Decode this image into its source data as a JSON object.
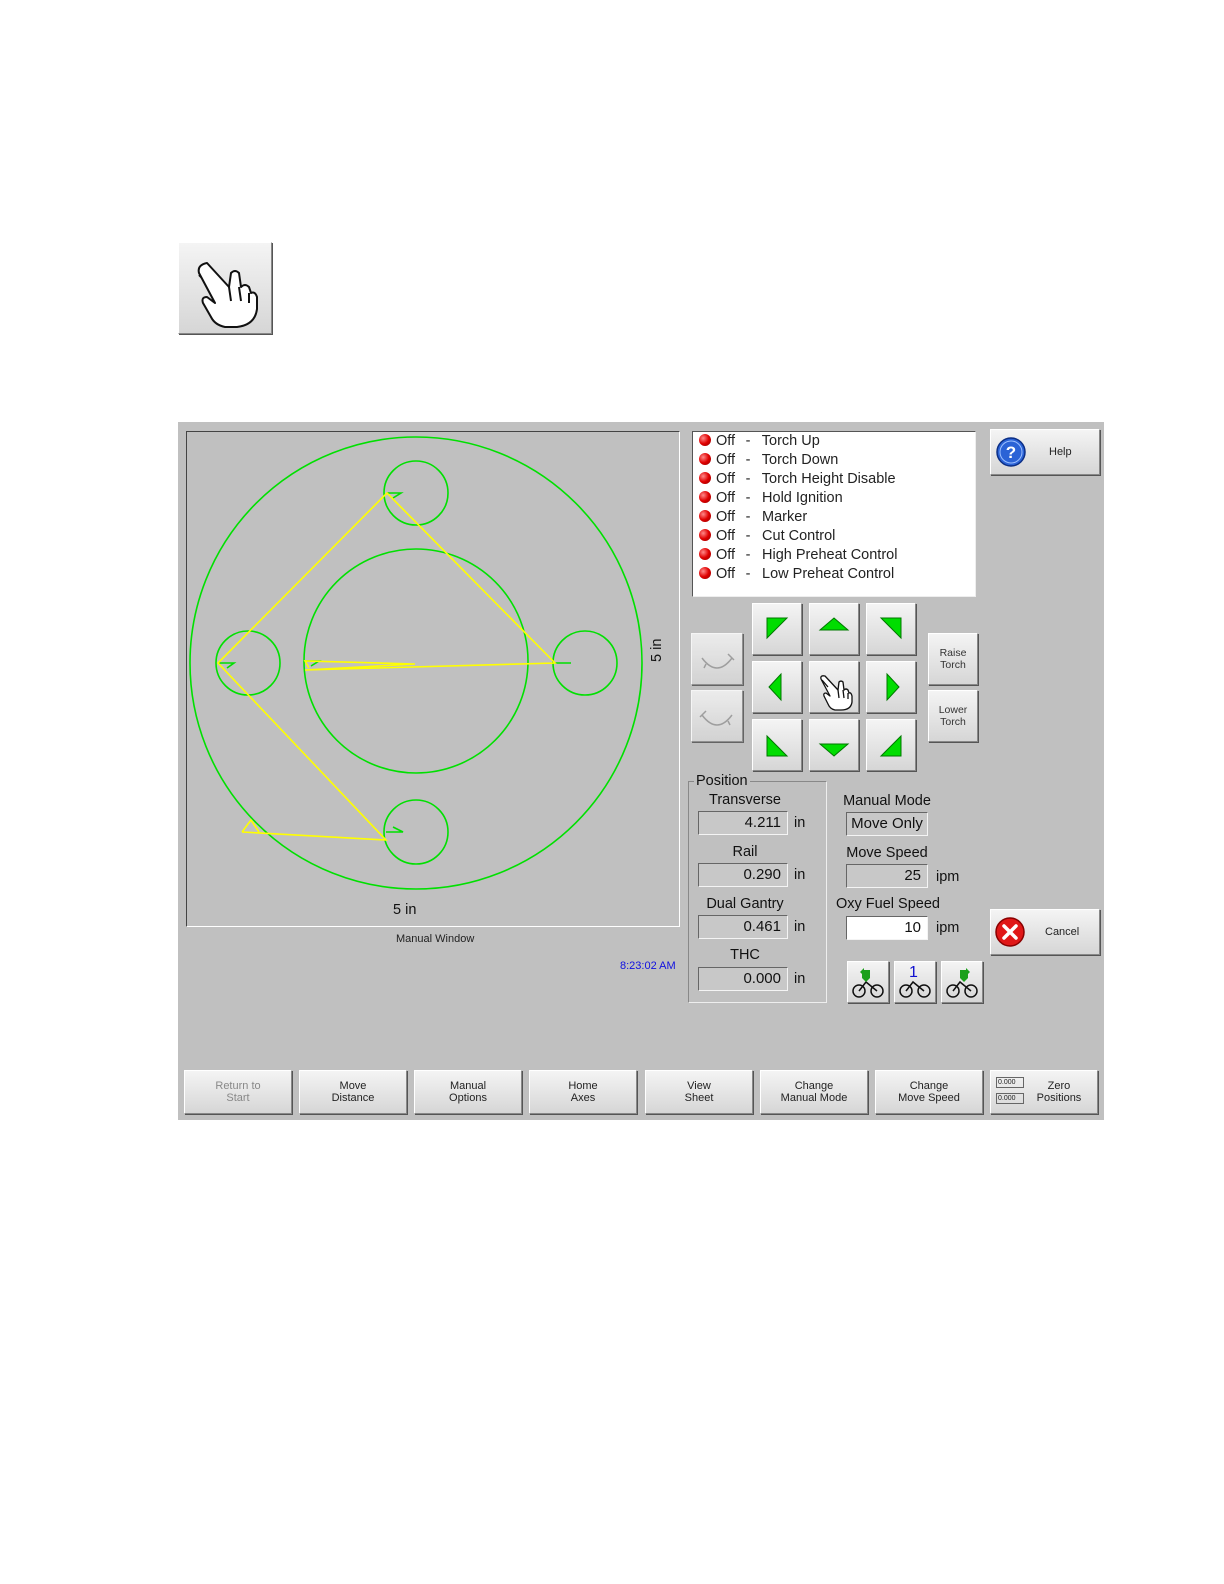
{
  "manual_window": {
    "x_dimension": "5 in",
    "y_dimension": "5 in",
    "caption": "Manual Window",
    "time": "8:23:02 AM"
  },
  "io_status": [
    {
      "state": "Off",
      "label": "Torch Up"
    },
    {
      "state": "Off",
      "label": "Torch Down"
    },
    {
      "state": "Off",
      "label": "Torch Height Disable"
    },
    {
      "state": "Off",
      "label": "Hold Ignition"
    },
    {
      "state": "Off",
      "label": "Marker"
    },
    {
      "state": "Off",
      "label": "Cut Control"
    },
    {
      "state": "Off",
      "label": "High Preheat Control"
    },
    {
      "state": "Off",
      "label": "Low Preheat Control"
    }
  ],
  "io_separator": "-",
  "help_label": "Help",
  "cancel_label": "Cancel",
  "raise_torch": {
    "line1": "Raise",
    "line2": "Torch"
  },
  "lower_torch": {
    "line1": "Lower",
    "line2": "Torch"
  },
  "position": {
    "title": "Position",
    "transverse": {
      "label": "Transverse",
      "value": "4.211",
      "unit": "in"
    },
    "rail": {
      "label": "Rail",
      "value": "0.290",
      "unit": "in"
    },
    "dual_gantry": {
      "label": "Dual Gantry",
      "value": "0.461",
      "unit": "in"
    },
    "thc": {
      "label": "THC",
      "value": "0.000",
      "unit": "in"
    }
  },
  "manual_mode": {
    "label": "Manual Mode",
    "value": "Move Only"
  },
  "move_speed": {
    "label": "Move Speed",
    "value": "25",
    "unit": "ipm"
  },
  "oxy_fuel_speed": {
    "label": "Oxy Fuel Speed",
    "value": "10",
    "unit": "ipm"
  },
  "station_number": "1",
  "softkeys": [
    {
      "line1": "Return to",
      "line2": "Start"
    },
    {
      "line1": "Move",
      "line2": "Distance"
    },
    {
      "line1": "Manual",
      "line2": "Options"
    },
    {
      "line1": "Home",
      "line2": "Axes"
    },
    {
      "line1": "View",
      "line2": "Sheet"
    },
    {
      "line1": "Change",
      "line2": "Manual Mode"
    },
    {
      "line1": "Change",
      "line2": "Move Speed"
    },
    {
      "line1": "Zero",
      "line2": "Positions"
    }
  ],
  "zero_icon_values": [
    "0.000",
    "0.000"
  ],
  "colors": {
    "part_outline": "#00e000",
    "traverse_path": "#ffff00",
    "time_text": "#1010e0",
    "arrow": "#00dd00"
  }
}
